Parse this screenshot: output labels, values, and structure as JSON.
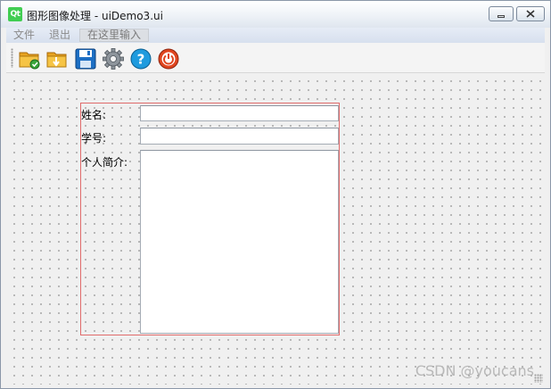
{
  "window": {
    "title": "图形图像处理 - uiDemo3.ui",
    "logo_text": "Qt"
  },
  "menubar": {
    "items": [
      {
        "label": "文件"
      },
      {
        "label": "退出"
      },
      {
        "label": "在这里输入"
      }
    ]
  },
  "toolbar": {
    "buttons": [
      {
        "icon": "open-folder-icon"
      },
      {
        "icon": "folder-export-icon"
      },
      {
        "icon": "save-floppy-icon"
      },
      {
        "icon": "settings-gear-icon"
      },
      {
        "icon": "help-question-icon"
      },
      {
        "icon": "power-exit-icon"
      }
    ]
  },
  "form": {
    "name_label": "姓名:",
    "name_value": "",
    "id_label": "学号:",
    "id_value": "",
    "intro_label": "个人简介:",
    "intro_value": ""
  },
  "watermark": "CSDN @youcans",
  "colors": {
    "layout_border": "#e06b6b",
    "menubar_bg": "#dfe6ef",
    "qt_green": "#41cd52"
  }
}
